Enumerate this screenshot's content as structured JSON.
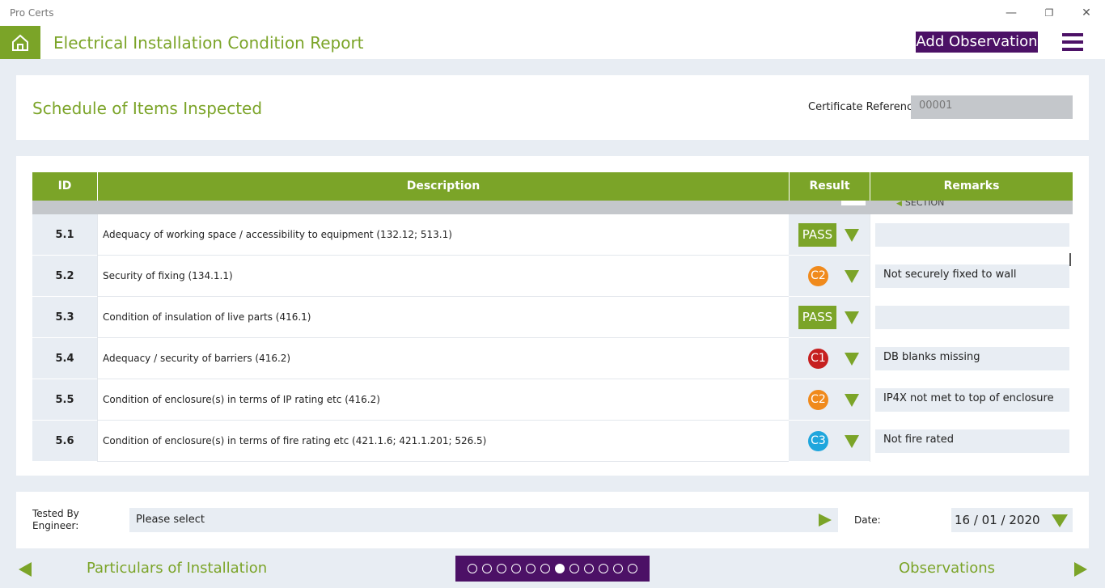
{
  "window": {
    "title": "Pro Certs",
    "minimize": "—",
    "restore": "❐",
    "close": "✕"
  },
  "appbar": {
    "title": "Electrical Installation Condition Report",
    "add_observation": "Add Observation"
  },
  "header": {
    "title": "Schedule of Items Inspected",
    "cert_ref_label": "Certificate Reference:",
    "cert_ref_value": "00001"
  },
  "table": {
    "columns": [
      "ID",
      "Description",
      "Result",
      "Remarks"
    ],
    "hidden_row_fragment": "SECTION",
    "rows": [
      {
        "id": "5.1",
        "description": "Adequacy of working space / accessibility to equipment (132.12; 513.1)",
        "result": "PASS",
        "remarks": ""
      },
      {
        "id": "5.2",
        "description": "Security of fixing (134.1.1)",
        "result": "C2",
        "remarks": "Not securely fixed to wall"
      },
      {
        "id": "5.3",
        "description": "Condition of insulation of live parts (416.1)",
        "result": "PASS",
        "remarks": ""
      },
      {
        "id": "5.4",
        "description": "Adequacy / security of barriers (416.2)",
        "result": "C1",
        "remarks": "DB blanks missing"
      },
      {
        "id": "5.5",
        "description": "Condition of enclosure(s) in terms of IP rating etc (416.2)",
        "result": "C2",
        "remarks": "IP4X not met to top of enclosure"
      },
      {
        "id": "5.6",
        "description": "Condition of enclosure(s) in terms of fire rating etc (421.1.6; 421.1.201; 526.5)",
        "result": "C3",
        "remarks": "Not fire rated"
      }
    ]
  },
  "footer": {
    "tested_by_label": "Tested By Engineer:",
    "tested_by_value": "Please select",
    "date_label": "Date:",
    "date_value": "16 / 01 / 2020"
  },
  "nav": {
    "prev": "Particulars of Installation",
    "next": "Observations",
    "page_count": 12,
    "current_page": 7
  },
  "colors": {
    "brand_green": "#7ba428",
    "brand_purple": "#4c1166",
    "C1": "#c62020",
    "C2": "#f08a1c",
    "C3": "#1fa6dd"
  }
}
